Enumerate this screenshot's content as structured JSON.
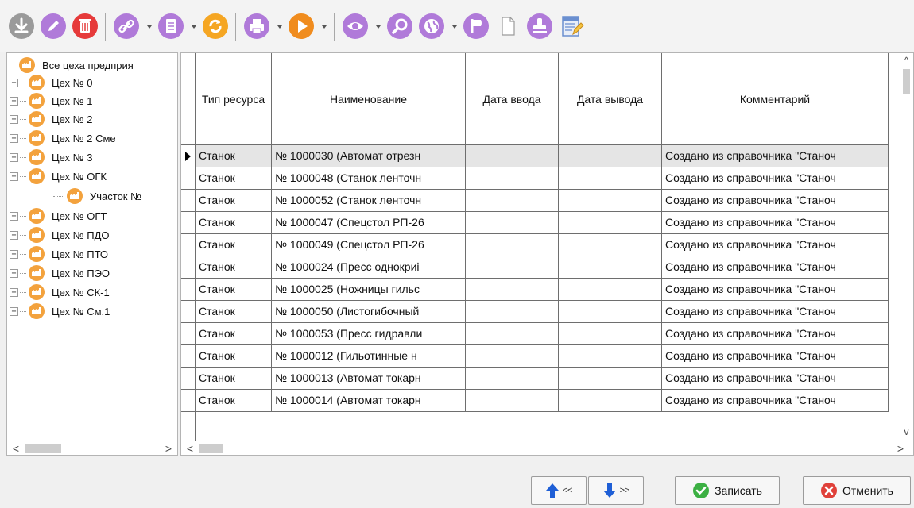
{
  "toolbar": {
    "icons": [
      {
        "name": "download-icon",
        "color": "#9a9a9a"
      },
      {
        "name": "edit-pencil-icon",
        "color": "#b07ad9"
      },
      {
        "name": "delete-trash-icon",
        "color": "#e63a3a"
      },
      {
        "name": "link-icon",
        "color": "#b07ad9"
      },
      {
        "name": "document-icon",
        "color": "#b07ad9"
      },
      {
        "name": "refresh-icon",
        "color": "#f5a623"
      },
      {
        "name": "print-icon",
        "color": "#b07ad9"
      },
      {
        "name": "play-icon",
        "color": "#f08c1e"
      },
      {
        "name": "view-eye-icon",
        "color": "#b07ad9"
      },
      {
        "name": "search-icon",
        "color": "#b07ad9"
      },
      {
        "name": "globe-icon",
        "color": "#b07ad9"
      },
      {
        "name": "flag-icon",
        "color": "#b07ad9"
      },
      {
        "name": "blank-page-icon",
        "color": "#ffffff"
      },
      {
        "name": "stamp-icon",
        "color": "#b07ad9"
      },
      {
        "name": "notepad-edit-icon",
        "color": "#6a8fd0"
      }
    ]
  },
  "tree": {
    "items": [
      {
        "label": "Все цеха предприя",
        "expander": ""
      },
      {
        "label": "Цех № 0",
        "expander": "+"
      },
      {
        "label": "Цех № 1",
        "expander": "+"
      },
      {
        "label": "Цех № 2",
        "expander": "+"
      },
      {
        "label": "Цех № 2 Сме",
        "expander": "+"
      },
      {
        "label": "Цех № 3",
        "expander": "+"
      },
      {
        "label": "Цех № ОГК",
        "expander": "−"
      },
      {
        "label": "Участок №",
        "expander": ""
      },
      {
        "label": "Цех № ОГТ",
        "expander": "+"
      },
      {
        "label": "Цех № ПДО",
        "expander": "+"
      },
      {
        "label": "Цех № ПТО",
        "expander": "+"
      },
      {
        "label": "Цех № ПЭО",
        "expander": "+"
      },
      {
        "label": "Цех № СК-1",
        "expander": "+"
      },
      {
        "label": "Цех № См.1",
        "expander": "+"
      }
    ]
  },
  "grid": {
    "headers": {
      "type": "Тип ресурса",
      "name": "Наименование",
      "date_in": "Дата ввода",
      "date_out": "Дата вывода",
      "comment": "Комментарий"
    },
    "rows": [
      {
        "type": "Станок",
        "name": "№ 1000030 (Автомат отрезн",
        "date_in": "",
        "date_out": "",
        "comment": "Создано из справочника \"Станоч"
      },
      {
        "type": "Станок",
        "name": "№ 1000048 (Станок ленточн",
        "date_in": "",
        "date_out": "",
        "comment": "Создано из справочника \"Станоч"
      },
      {
        "type": "Станок",
        "name": "№ 1000052 (Станок ленточн",
        "date_in": "",
        "date_out": "",
        "comment": "Создано из справочника \"Станоч"
      },
      {
        "type": "Станок",
        "name": "№ 1000047 (Спецстол РП-26",
        "date_in": "",
        "date_out": "",
        "comment": "Создано из справочника \"Станоч"
      },
      {
        "type": "Станок",
        "name": "№ 1000049 (Спецстол РП-26",
        "date_in": "",
        "date_out": "",
        "comment": "Создано из справочника \"Станоч"
      },
      {
        "type": "Станок",
        "name": "№ 1000024 (Пресс однокриі",
        "date_in": "",
        "date_out": "",
        "comment": "Создано из справочника \"Станоч"
      },
      {
        "type": "Станок",
        "name": "№ 1000025 (Ножницы гильс",
        "date_in": "",
        "date_out": "",
        "comment": "Создано из справочника \"Станоч"
      },
      {
        "type": "Станок",
        "name": "№ 1000050 (Листогибочный",
        "date_in": "",
        "date_out": "",
        "comment": "Создано из справочника \"Станоч"
      },
      {
        "type": "Станок",
        "name": "№ 1000053 (Пресс гидравли",
        "date_in": "",
        "date_out": "",
        "comment": "Создано из справочника \"Станоч"
      },
      {
        "type": "Станок",
        "name": "№ 1000012 (Гильотинные н",
        "date_in": "",
        "date_out": "",
        "comment": "Создано из справочника \"Станоч"
      },
      {
        "type": "Станок",
        "name": "№ 1000013 (Автомат токарн",
        "date_in": "",
        "date_out": "",
        "comment": "Создано из справочника \"Станоч"
      },
      {
        "type": "Станок",
        "name": "№ 1000014 (Автомат токарн",
        "date_in": "",
        "date_out": "",
        "comment": "Создано из справочника \"Станоч"
      }
    ]
  },
  "scroll": {
    "left_arrow": "<",
    "right_arrow": ">",
    "up_arrow": "^",
    "down_arrow": "v"
  },
  "buttons": {
    "prev_label": "<<",
    "next_label": ">>",
    "save_label": "Записать",
    "cancel_label": "Отменить"
  },
  "colors": {
    "accent_purple": "#b07ad9",
    "tree_icon": "#f3a23d",
    "save_green": "#3cb043",
    "cancel_red": "#e0413a",
    "nav_blue": "#1f5fd6"
  }
}
